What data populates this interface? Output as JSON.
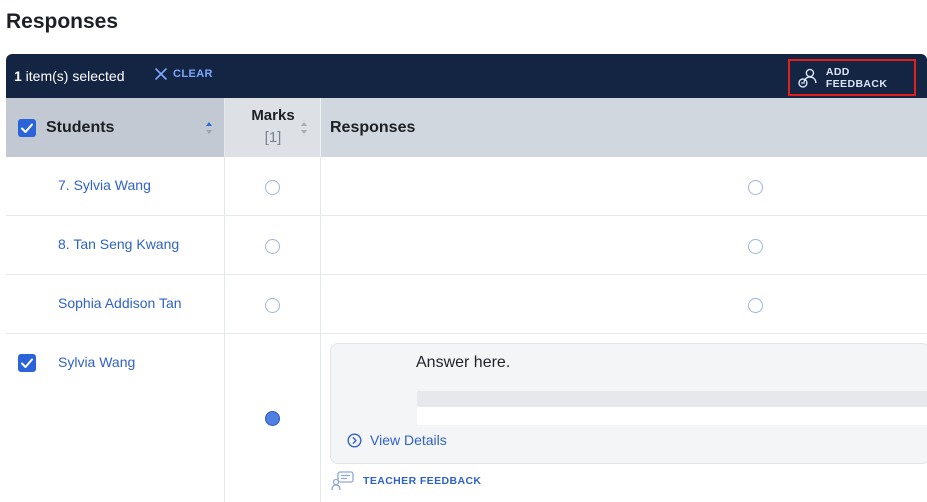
{
  "page": {
    "title": "Responses"
  },
  "toolbar": {
    "selected_count": "1",
    "selected_suffix": " item(s) selected",
    "clear_label": "CLEAR",
    "add_feedback_label": "ADD FEEDBACK"
  },
  "columns": {
    "students": "Students",
    "marks": "Marks",
    "marks_sub": "[1]",
    "responses": "Responses"
  },
  "rows": [
    {
      "student": "7. Sylvia Wang",
      "checked": false,
      "mark_selected": false
    },
    {
      "student": "8. Tan Seng Kwang",
      "checked": false,
      "mark_selected": false
    },
    {
      "student": "Sophia Addison Tan",
      "checked": false,
      "mark_selected": false
    },
    {
      "student": "Sylvia Wang",
      "checked": true,
      "mark_selected": true,
      "response_text": "Answer here.",
      "view_details_label": "View Details",
      "teacher_feedback_label": "TEACHER FEEDBACK"
    }
  ],
  "colors": {
    "toolbar_bg": "#142544",
    "link": "#2f62c8",
    "checkbox": "#2b63d9",
    "highlight_border": "#e0201b"
  },
  "icons": {
    "clear": "close-icon",
    "add_feedback": "feedback-person-icon",
    "sort": "sort-icon",
    "view_details": "chevron-circle-right-icon",
    "teacher_feedback": "feedback-bubble-icon"
  }
}
